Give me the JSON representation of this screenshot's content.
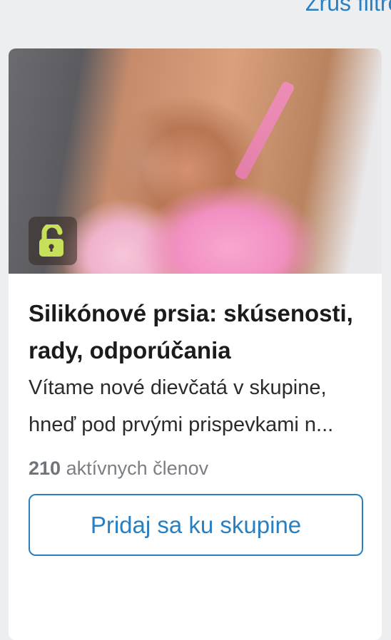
{
  "header": {
    "top_link": "Zruš filtre"
  },
  "group_card": {
    "cover_image": "group-cover-image",
    "lock_icon": "unlocked-padlock-icon",
    "lock_color": "#c6e05a",
    "title": "Silikónové prsia: skúsenosti, rady, odporúčania",
    "description": "Vítame nové dievčatá v skupine, hneď pod prvými prispevkami n...",
    "member_count": "210",
    "member_label": "aktívnych členov",
    "join_button_label": "Pridaj sa ku skupine"
  },
  "colors": {
    "accent": "#2a7fc1",
    "background": "#edeef0"
  }
}
